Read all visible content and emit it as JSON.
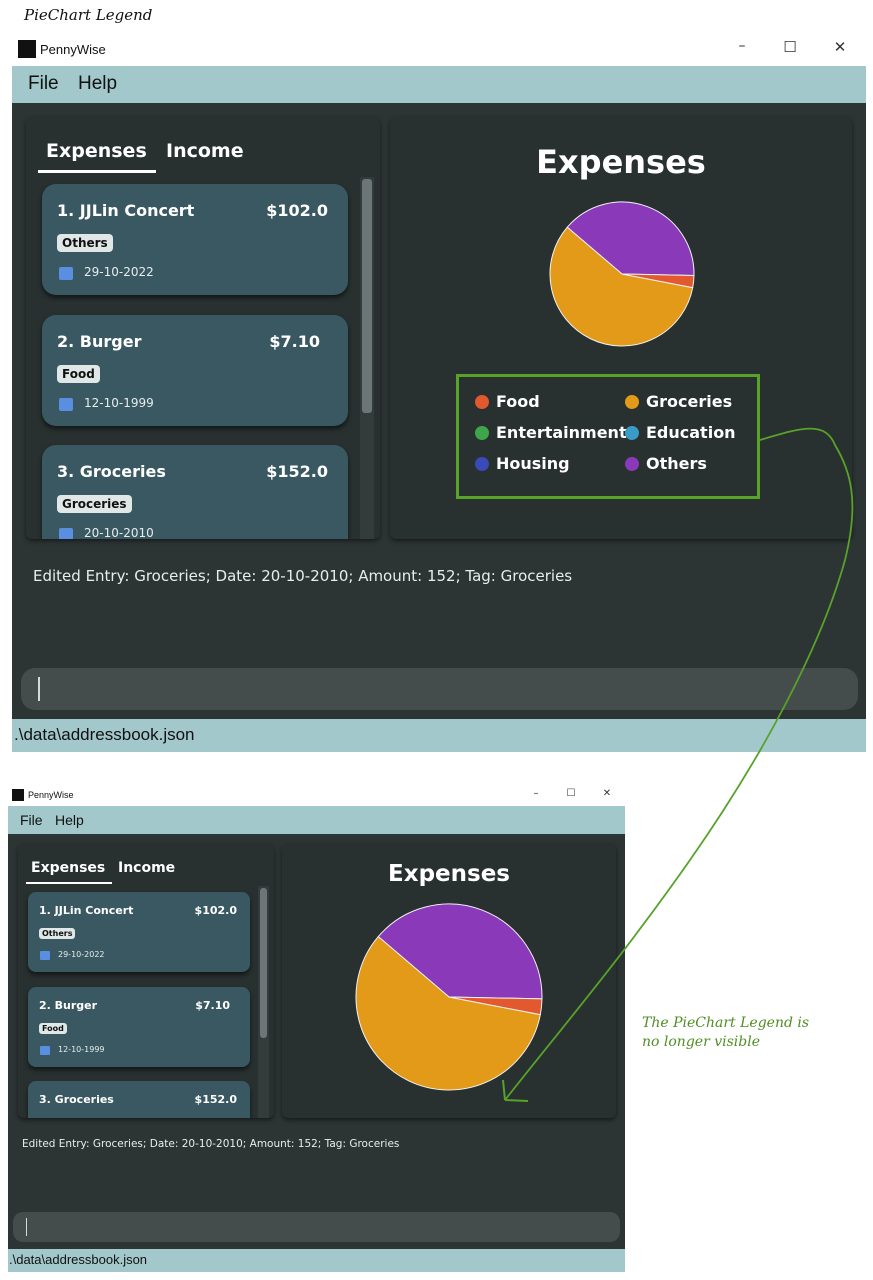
{
  "annotation": {
    "title": "PieChart Legend",
    "note_line1": "The PieChart Legend is",
    "note_line2": "no longer visible"
  },
  "window": {
    "title": "PennyWise",
    "controls": {
      "minimize": "–",
      "maximize": "☐",
      "close": "✕"
    }
  },
  "menu": {
    "file": "File",
    "help": "Help"
  },
  "tabs": {
    "expenses": "Expenses",
    "income": "Income"
  },
  "entries": [
    {
      "name": "1.  JJLin Concert",
      "amount": "$102.0",
      "tag": "Others",
      "date": "29-10-2022"
    },
    {
      "name": "2.  Burger",
      "amount": "$7.10",
      "tag": "Food",
      "date": "12-10-1999"
    },
    {
      "name": "3.  Groceries",
      "amount": "$152.0",
      "tag": "Groceries",
      "date": "20-10-2010"
    }
  ],
  "chart": {
    "title": "Expenses"
  },
  "chart_data": {
    "type": "pie",
    "title": "Expenses",
    "categories": [
      "Food",
      "Groceries",
      "Entertainment",
      "Education",
      "Housing",
      "Others"
    ],
    "values": [
      7.1,
      152.0,
      0,
      0,
      0,
      102.0
    ],
    "colors": [
      "#e2582f",
      "#e39a18",
      "#3fa54a",
      "#3a9bc7",
      "#3a4ab7",
      "#8a3ab8"
    ],
    "legend_position": "bottom"
  },
  "legend": [
    {
      "label": "Food",
      "color": "#e2582f"
    },
    {
      "label": "Groceries",
      "color": "#e39a18"
    },
    {
      "label": "Entertainment",
      "color": "#3fa54a"
    },
    {
      "label": "Education",
      "color": "#3a9bc7"
    },
    {
      "label": "Housing",
      "color": "#3a4ab7"
    },
    {
      "label": "Others",
      "color": "#8a3ab8"
    }
  ],
  "result": {
    "text": "Edited Entry: Groceries; Date: 20-10-2010; Amount: 152; Tag: Groceries"
  },
  "command": {
    "value": ""
  },
  "status": {
    "path": ".\\data\\addressbook.json"
  },
  "colors": {
    "menubar": "#a2c8cb",
    "background": "#2d3434",
    "card": "#3a5861",
    "annotation": "#58a22a"
  }
}
